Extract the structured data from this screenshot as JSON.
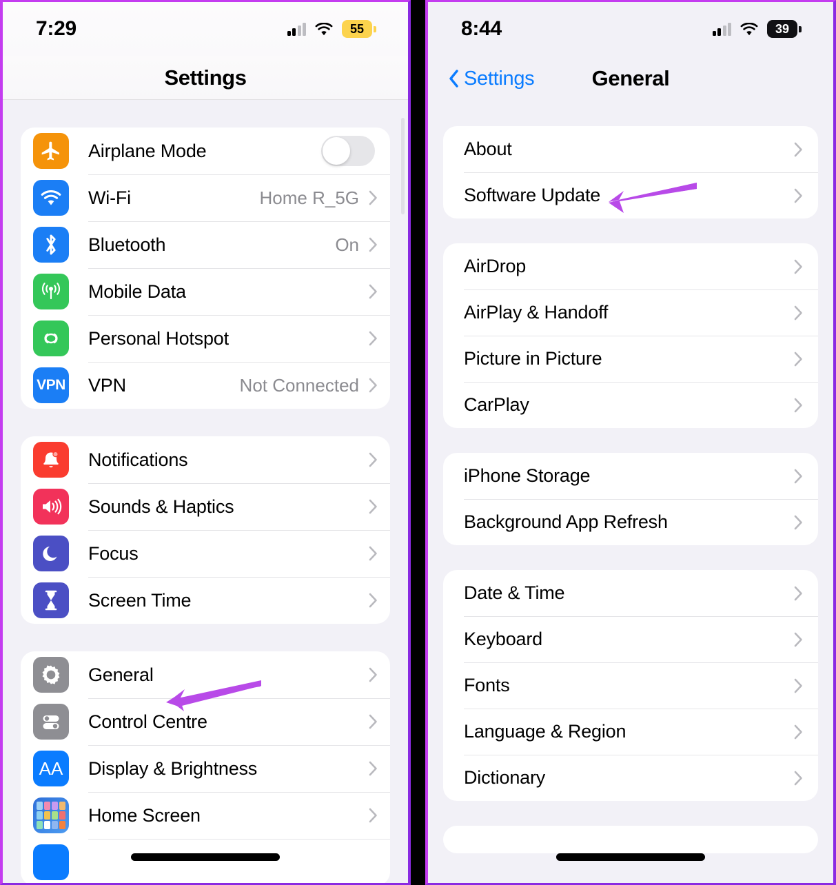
{
  "colors": {
    "annotation_arrow": "#b84ae8",
    "frame_border": "#c43cf0",
    "ios_blue": "#0a7cff",
    "page_bg": "#f2f1f7",
    "card_bg": "#ffffff",
    "secondary_text": "#8b8b90",
    "battery_yellow": "#fcd34d",
    "battery_dark": "#111114"
  },
  "left_panel": {
    "status_bar": {
      "time": "7:29",
      "battery_level": "55",
      "battery_style": "low-power-yellow",
      "cellular_icon": "signal-bars-icon",
      "wifi_icon": "wifi-icon"
    },
    "nav": {
      "title": "Settings"
    },
    "groups": [
      {
        "rows": [
          {
            "label": "Airplane Mode",
            "icon": "airplane-icon",
            "icon_bg": "#f5930a",
            "control": "toggle",
            "toggle_on": false
          },
          {
            "label": "Wi-Fi",
            "icon": "wifi-icon",
            "icon_bg": "#1b7ef5",
            "value": "Home R_5G",
            "control": "chevron"
          },
          {
            "label": "Bluetooth",
            "icon": "bluetooth-icon",
            "icon_bg": "#1b7ef5",
            "value": "On",
            "control": "chevron"
          },
          {
            "label": "Mobile Data",
            "icon": "cellular-tower-icon",
            "icon_bg": "#34c759",
            "value": "",
            "control": "chevron"
          },
          {
            "label": "Personal Hotspot",
            "icon": "hotspot-link-icon",
            "icon_bg": "#34c759",
            "value": "",
            "control": "chevron"
          },
          {
            "label": "VPN",
            "icon": "vpn-icon",
            "icon_bg": "#1b7ef5",
            "value": "Not Connected",
            "control": "chevron"
          }
        ]
      },
      {
        "rows": [
          {
            "label": "Notifications",
            "icon": "bell-icon",
            "icon_bg": "#fa3c2f",
            "value": "",
            "control": "chevron"
          },
          {
            "label": "Sounds & Haptics",
            "icon": "speaker-icon",
            "icon_bg": "#f2325a",
            "value": "",
            "control": "chevron"
          },
          {
            "label": "Focus",
            "icon": "moon-icon",
            "icon_bg": "#4b4fc4",
            "value": "",
            "control": "chevron"
          },
          {
            "label": "Screen Time",
            "icon": "hourglass-icon",
            "icon_bg": "#4b4fc4",
            "value": "",
            "control": "chevron"
          }
        ]
      },
      {
        "rows": [
          {
            "label": "General",
            "icon": "gear-icon",
            "icon_bg": "#8e8e93",
            "value": "",
            "control": "chevron",
            "annotated": true
          },
          {
            "label": "Control Centre",
            "icon": "sliders-icon",
            "icon_bg": "#8e8e93",
            "value": "",
            "control": "chevron"
          },
          {
            "label": "Display & Brightness",
            "icon": "aa-text-icon",
            "icon_bg": "#0a7cff",
            "value": "",
            "control": "chevron"
          },
          {
            "label": "Home Screen",
            "icon": "home-screen-grid-icon",
            "icon_bg": "#3f8ae8",
            "value": "",
            "control": "chevron"
          }
        ]
      }
    ]
  },
  "right_panel": {
    "status_bar": {
      "time": "8:44",
      "battery_level": "39",
      "battery_style": "dark-pill",
      "cellular_icon": "signal-bars-icon",
      "wifi_icon": "wifi-icon"
    },
    "nav": {
      "back_label": "Settings",
      "back_icon": "chevron-left-icon",
      "title": "General"
    },
    "groups": [
      {
        "rows": [
          {
            "label": "About",
            "control": "chevron"
          },
          {
            "label": "Software Update",
            "control": "chevron",
            "annotated": true
          }
        ]
      },
      {
        "rows": [
          {
            "label": "AirDrop",
            "control": "chevron"
          },
          {
            "label": "AirPlay & Handoff",
            "control": "chevron"
          },
          {
            "label": "Picture in Picture",
            "control": "chevron"
          },
          {
            "label": "CarPlay",
            "control": "chevron"
          }
        ]
      },
      {
        "rows": [
          {
            "label": "iPhone Storage",
            "control": "chevron"
          },
          {
            "label": "Background App Refresh",
            "control": "chevron"
          }
        ]
      },
      {
        "rows": [
          {
            "label": "Date & Time",
            "control": "chevron"
          },
          {
            "label": "Keyboard",
            "control": "chevron"
          },
          {
            "label": "Fonts",
            "control": "chevron"
          },
          {
            "label": "Language & Region",
            "control": "chevron"
          },
          {
            "label": "Dictionary",
            "control": "chevron"
          }
        ]
      }
    ]
  }
}
